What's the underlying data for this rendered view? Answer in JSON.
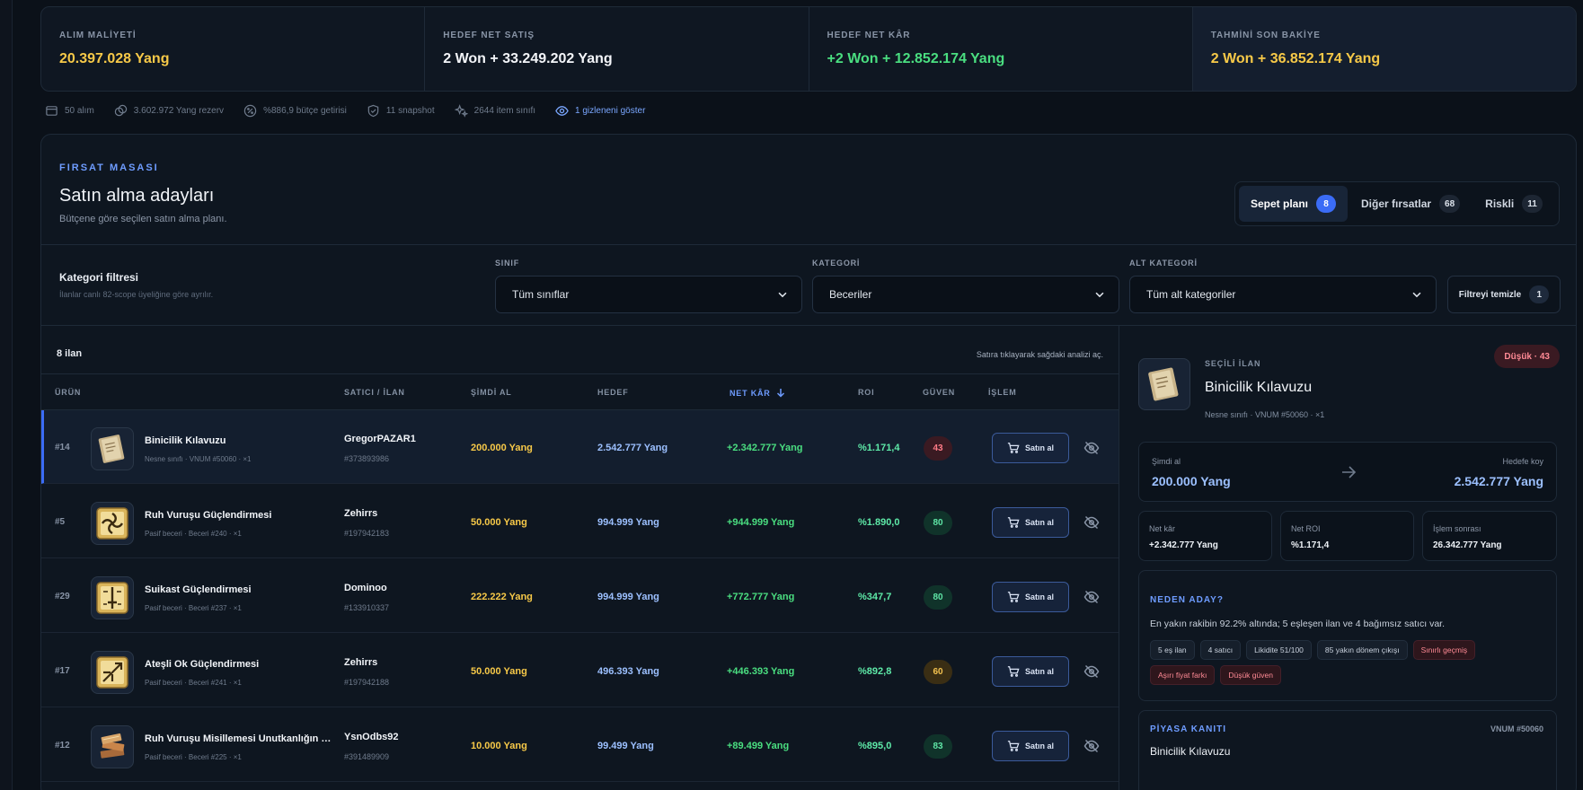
{
  "stats": [
    {
      "label": "ALIM MALİYETİ",
      "value": "20.397.028 Yang",
      "tone": "gold"
    },
    {
      "label": "HEDEF NET SATIŞ",
      "value": "2 Won + 33.249.202 Yang",
      "tone": "white"
    },
    {
      "label": "HEDEF NET KÂR",
      "value": "+2 Won + 12.852.174 Yang",
      "tone": "green"
    },
    {
      "label": "TAHMİNİ SON BAKİYE",
      "value": "2 Won + 36.852.174 Yang",
      "tone": "gold"
    }
  ],
  "meta": {
    "purchases": "50 alım",
    "reserve": "3.602.972 Yang rezerv",
    "budget_return": "%886,9 bütçe getirisi",
    "snapshots": "11 snapshot",
    "item_classes": "2644 item sınıfı",
    "show_hidden": "1 gizleneni göster"
  },
  "panel": {
    "eyebrow": "FIRSAT MASASI",
    "title": "Satın alma adayları",
    "subtitle": "Bütçene göre seçilen satın alma planı."
  },
  "tabs": [
    {
      "label": "Sepet planı",
      "count": "8"
    },
    {
      "label": "Diğer fırsatlar",
      "count": "68"
    },
    {
      "label": "Riskli",
      "count": "11"
    }
  ],
  "filters": {
    "title": "Kategori filtresi",
    "subtitle": "İlanlar canlı 82-scope üyeliğine göre ayrılır.",
    "class_label": "SINIF",
    "class_value": "Tüm sınıflar",
    "category_label": "KATEGORİ",
    "category_value": "Beceriler",
    "subcategory_label": "ALT KATEGORİ",
    "subcategory_value": "Tüm alt kategoriler",
    "clear_label": "Filtreyi temizle",
    "clear_count": "1"
  },
  "table": {
    "count": "8 ilan",
    "hint": "Satıra tıklayarak sağdaki analizi aç.",
    "headers": {
      "product": "ÜRÜN",
      "seller": "SATICI / İLAN",
      "buy_now": "ŞİMDİ AL",
      "target": "HEDEF",
      "net_profit": "NET KÂR",
      "roi": "ROI",
      "trust": "GÜVEN",
      "action": "İŞLEM"
    },
    "buy_label": "Satın al",
    "rows": [
      {
        "rank": "#14",
        "name": "Binicilik Kılavuzu",
        "meta": "Nesne sınıfı · VNUM #50060 · ×1",
        "seller": "GregorPAZAR1",
        "seller_id": "#373893986",
        "buy": "200.000 Yang",
        "target": "2.542.777 Yang",
        "profit": "+2.342.777 Yang",
        "roi": "%1.171,4",
        "trust": "43",
        "trust_level": "low",
        "icon": "book"
      },
      {
        "rank": "#5",
        "name": "Ruh Vuruşu Güçlendirmesi",
        "meta": "Pasif beceri · Beceri #240 · ×1",
        "seller": "Zehirrs",
        "seller_id": "#197942183",
        "buy": "50.000 Yang",
        "target": "994.999 Yang",
        "profit": "+944.999 Yang",
        "roi": "%1.890,0",
        "trust": "80",
        "trust_level": "high",
        "icon": "skill-spiral"
      },
      {
        "rank": "#29",
        "name": "Suikast Güçlendirmesi",
        "meta": "Pasif beceri · Beceri #237 · ×1",
        "seller": "Dominoo",
        "seller_id": "#133910337",
        "buy": "222.222 Yang",
        "target": "994.999 Yang",
        "profit": "+772.777 Yang",
        "roi": "%347,7",
        "trust": "80",
        "trust_level": "high",
        "icon": "skill-dagger"
      },
      {
        "rank": "#17",
        "name": "Ateşli Ok Güçlendirmesi",
        "meta": "Pasif beceri · Beceri #241 · ×1",
        "seller": "Zehirrs",
        "seller_id": "#197942188",
        "buy": "50.000 Yang",
        "target": "496.393 Yang",
        "profit": "+446.393 Yang",
        "roi": "%892,8",
        "trust": "60",
        "trust_level": "mid",
        "icon": "skill-arrow"
      },
      {
        "rank": "#12",
        "name": "Ruh Vuruşu Misillemesi Unutkanlığın Kitabı",
        "meta": "Pasif beceri · Beceri #225 · ×1",
        "seller": "YsnOdbs92",
        "seller_id": "#391489909",
        "buy": "10.000 Yang",
        "target": "99.499 Yang",
        "profit": "+89.499 Yang",
        "roi": "%895,0",
        "trust": "83",
        "trust_level": "high",
        "icon": "books"
      }
    ]
  },
  "detail": {
    "eyebrow": "SEÇİLİ İLAN",
    "title": "Binicilik Kılavuzu",
    "meta": "Nesne sınıfı · VNUM #50060 · ×1",
    "badge": "Düşük · 43",
    "buy_now_label": "Şimdi al",
    "buy_now_value": "200.000 Yang",
    "target_label": "Hedefe koy",
    "target_value": "2.542.777 Yang",
    "metrics": [
      {
        "label": "Net kâr",
        "value": "+2.342.777 Yang"
      },
      {
        "label": "Net ROI",
        "value": "%1.171,4"
      },
      {
        "label": "İşlem sonrası",
        "value": "26.342.777 Yang"
      }
    ],
    "why_title": "NEDEN ADAY?",
    "why_text": "En yakın rakibin 92.2% altında; 5 eşleşen ilan ve 4 bağımsız satıcı var.",
    "chips": [
      {
        "label": "5 eş ilan",
        "warn": false
      },
      {
        "label": "4 satıcı",
        "warn": false
      },
      {
        "label": "Likidite 51/100",
        "warn": false
      },
      {
        "label": "85 yakın dönem çıkışı",
        "warn": false
      },
      {
        "label": "Sınırlı geçmiş",
        "warn": true
      },
      {
        "label": "Aşırı fiyat farkı",
        "warn": true
      },
      {
        "label": "Düşük güven",
        "warn": true
      }
    ],
    "market_title": "PİYASA KANITI",
    "market_vnum": "VNUM #50060",
    "market_item": "Binicilik Kılavuzu"
  }
}
